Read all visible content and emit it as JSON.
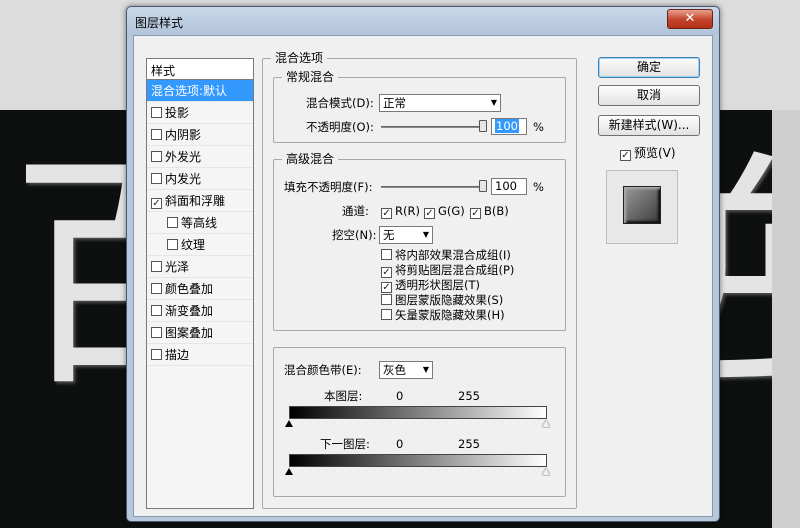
{
  "background": {
    "glyph_left": "百",
    "glyph_right": "逆"
  },
  "dialog": {
    "title": "图层样式",
    "close_glyph": "✕"
  },
  "styles": {
    "header": "样式",
    "items": [
      {
        "label": "混合选项:默认",
        "selected": true,
        "checkbox": false,
        "checked": false,
        "sub": false
      },
      {
        "label": "投影",
        "selected": false,
        "checkbox": true,
        "checked": false,
        "sub": false
      },
      {
        "label": "内阴影",
        "selected": false,
        "checkbox": true,
        "checked": false,
        "sub": false
      },
      {
        "label": "外发光",
        "selected": false,
        "checkbox": true,
        "checked": false,
        "sub": false
      },
      {
        "label": "内发光",
        "selected": false,
        "checkbox": true,
        "checked": false,
        "sub": false
      },
      {
        "label": "斜面和浮雕",
        "selected": false,
        "checkbox": true,
        "checked": true,
        "sub": false
      },
      {
        "label": "等高线",
        "selected": false,
        "checkbox": true,
        "checked": false,
        "sub": true
      },
      {
        "label": "纹理",
        "selected": false,
        "checkbox": true,
        "checked": false,
        "sub": true
      },
      {
        "label": "光泽",
        "selected": false,
        "checkbox": true,
        "checked": false,
        "sub": false
      },
      {
        "label": "颜色叠加",
        "selected": false,
        "checkbox": true,
        "checked": false,
        "sub": false
      },
      {
        "label": "渐变叠加",
        "selected": false,
        "checkbox": true,
        "checked": false,
        "sub": false
      },
      {
        "label": "图案叠加",
        "selected": false,
        "checkbox": true,
        "checked": false,
        "sub": false
      },
      {
        "label": "描边",
        "selected": false,
        "checkbox": true,
        "checked": false,
        "sub": false
      }
    ]
  },
  "blend_options": {
    "title": "混合选项",
    "general": {
      "title": "常规混合",
      "mode_label": "混合模式(D):",
      "mode_value": "正常",
      "opacity_label": "不透明度(O):",
      "opacity_value": "100",
      "opacity_level": 1.0,
      "unit": "%"
    },
    "advanced": {
      "title": "高级混合",
      "fill_label": "填充不透明度(F):",
      "fill_value": "100",
      "fill_level": 1.0,
      "unit": "%",
      "channels_label": "通道:",
      "channels": [
        {
          "label": "R(R)",
          "checked": true
        },
        {
          "label": "G(G)",
          "checked": true
        },
        {
          "label": "B(B)",
          "checked": true
        }
      ],
      "knockout_label": "挖空(N):",
      "knockout_value": "无",
      "options": [
        {
          "label": "将内部效果混合成组(I)",
          "checked": false
        },
        {
          "label": "将剪贴图层混合成组(P)",
          "checked": true
        },
        {
          "label": "透明形状图层(T)",
          "checked": true
        },
        {
          "label": "图层蒙版隐藏效果(S)",
          "checked": false
        },
        {
          "label": "矢量蒙版隐藏效果(H)",
          "checked": false
        }
      ]
    },
    "blend_if": {
      "label": "混合颜色带(E):",
      "value": "灰色",
      "this_layer_label": "本图层:",
      "this_layer_min": "0",
      "this_layer_max": "255",
      "underlying_label": "下一图层:",
      "underlying_min": "0",
      "underlying_max": "255"
    }
  },
  "buttons": {
    "ok": "确定",
    "cancel": "取消",
    "new_style": "新建样式(W)...",
    "preview_label": "预览(V)",
    "preview_checked": true
  },
  "check_glyph": "✓",
  "colors": {
    "selection": "#3399ff",
    "titlebar": "#b7c8dc",
    "close": "#c3412a"
  }
}
